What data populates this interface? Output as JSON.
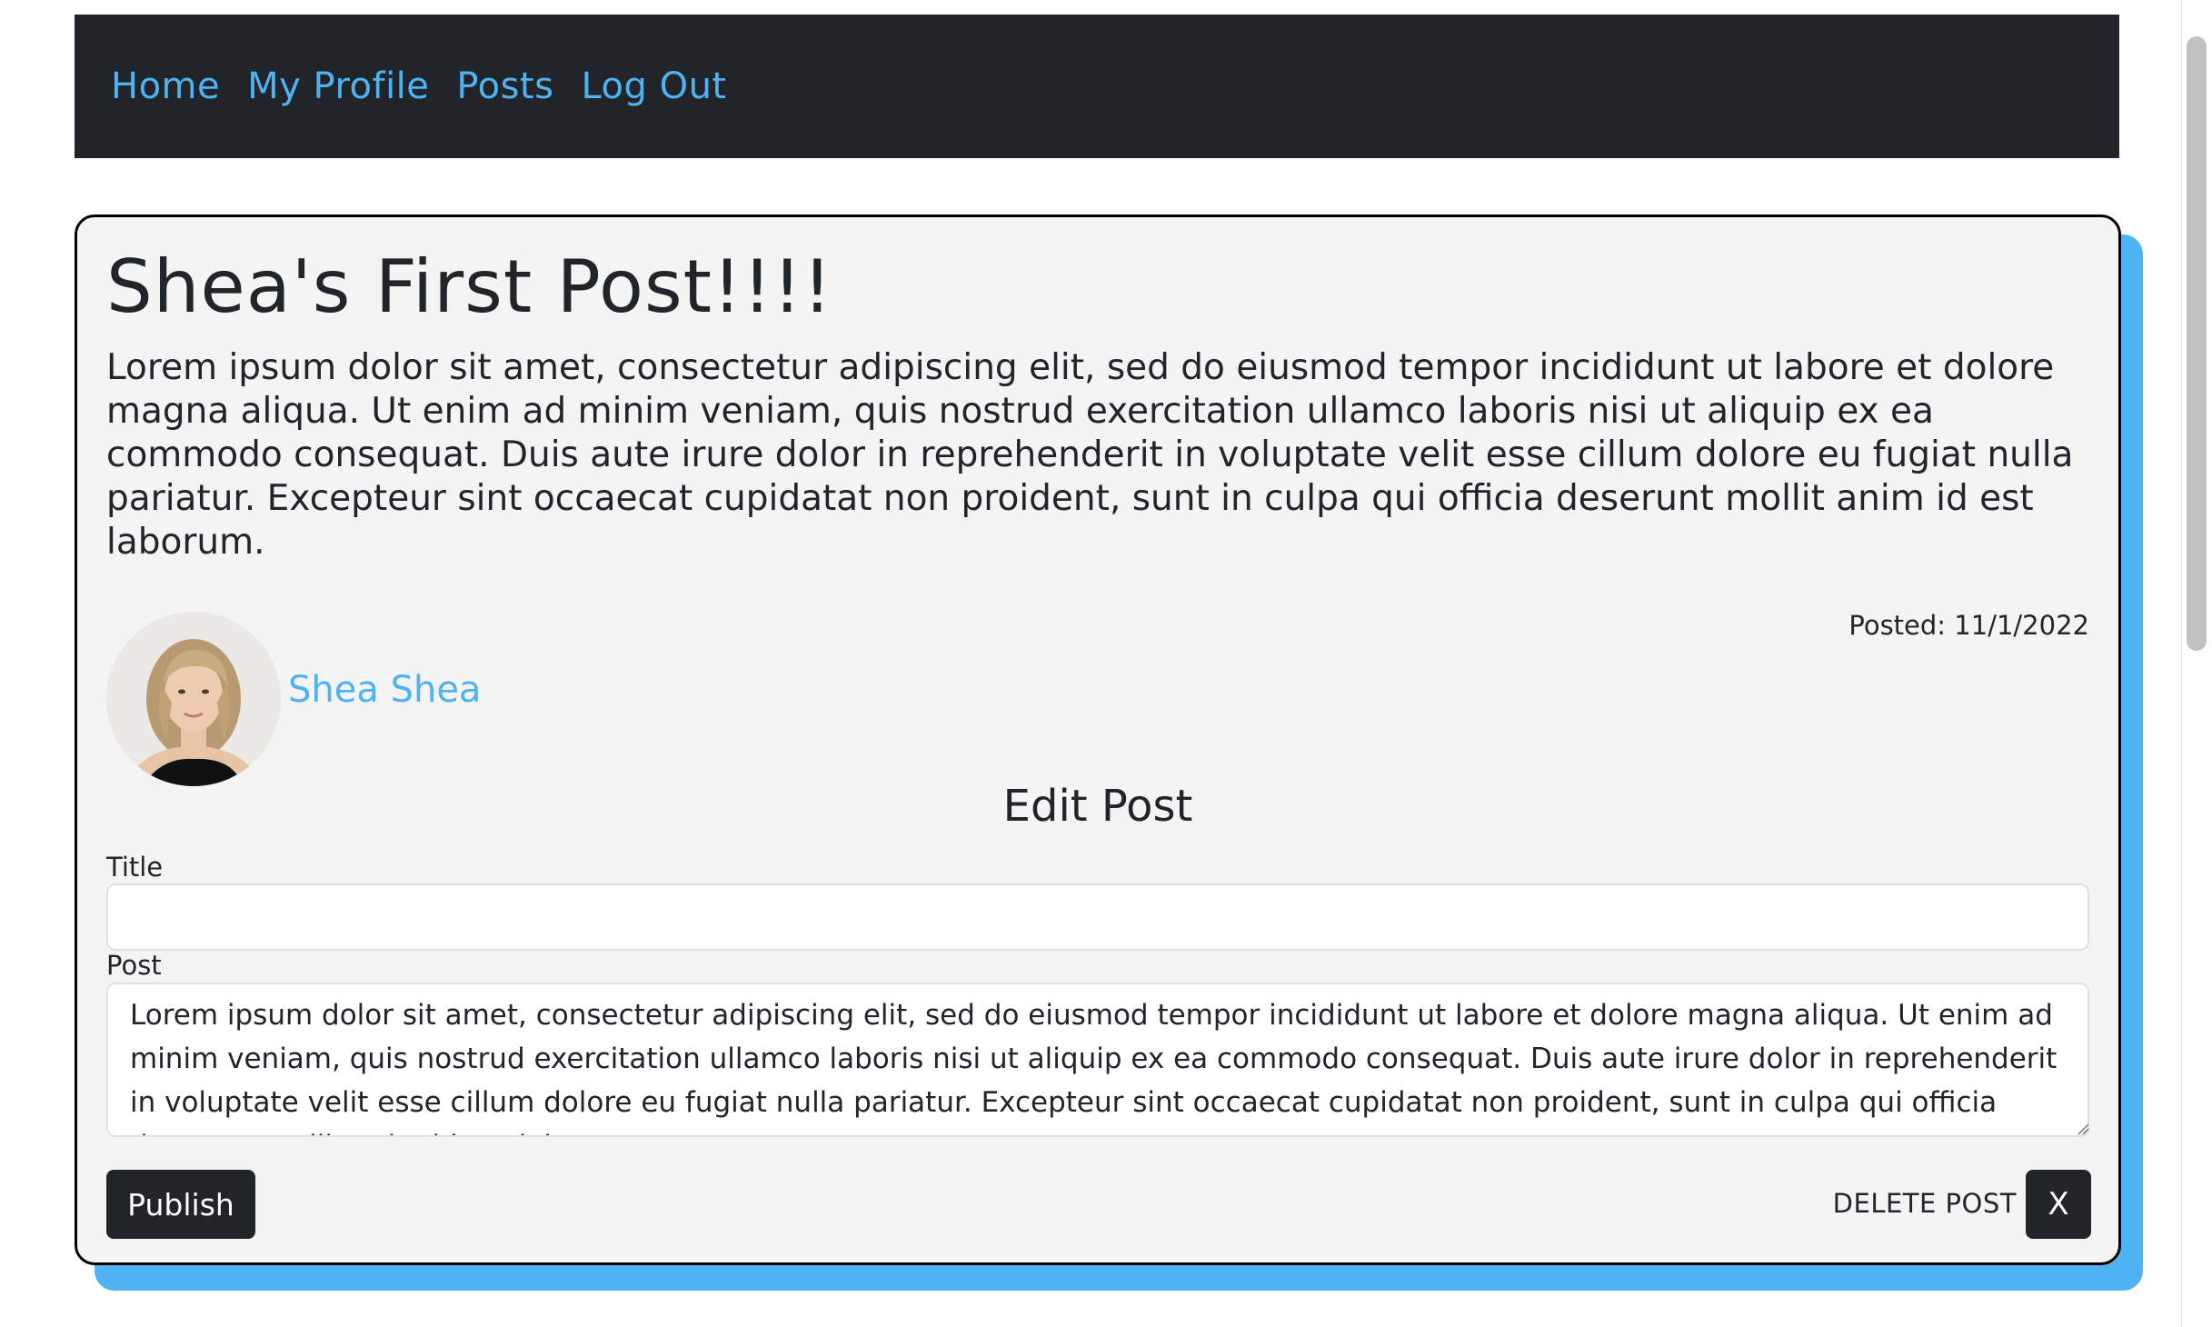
{
  "nav": {
    "items": [
      {
        "label": "Home"
      },
      {
        "label": "My Profile"
      },
      {
        "label": "Posts"
      },
      {
        "label": "Log Out"
      }
    ]
  },
  "post": {
    "title": "Shea's First Post!!!!",
    "body": "Lorem ipsum dolor sit amet, consectetur adipiscing elit, sed do eiusmod tempor incididunt ut labore et dolore magna aliqua. Ut enim ad minim veniam, quis nostrud exercitation ullamco laboris nisi ut aliquip ex ea commodo consequat. Duis aute irure dolor in reprehenderit in voluptate velit esse cillum dolore eu fugiat nulla pariatur. Excepteur sint occaecat cupidatat non proident, sunt in culpa qui officia deserunt mollit anim id est laborum.",
    "posted": "Posted: 11/1/2022",
    "author": "Shea Shea"
  },
  "edit_form": {
    "heading": "Edit Post",
    "title_label": "Title",
    "title_value": "",
    "post_label": "Post",
    "post_value": "Lorem ipsum dolor sit amet, consectetur adipiscing elit, sed do eiusmod tempor incididunt ut labore et dolore magna aliqua. Ut enim ad minim veniam, quis nostrud exercitation ullamco laboris nisi ut aliquip ex ea commodo consequat. Duis aute irure dolor in reprehenderit in voluptate velit esse cillum dolore eu fugiat nulla pariatur. Excepteur sint occaecat cupidatat non proident, sunt in culpa qui officia deserunt mollit anim id est laborum.",
    "publish_label": "Publish",
    "delete_label": "DELETE POST",
    "delete_button_label": "X"
  },
  "colors": {
    "navbar_bg": "#212529",
    "link": "#4fb3f3",
    "card_bg": "#f4f4f4",
    "card_shadow": "#4fb3f3",
    "button_bg": "#212529"
  },
  "icons": {
    "avatar": "user-avatar-photo",
    "resize": "resize-grip-icon"
  }
}
